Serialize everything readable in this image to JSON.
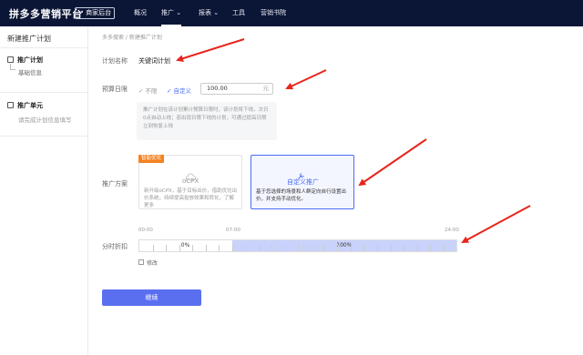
{
  "header": {
    "brand": "拼多多营销平台",
    "store_button": "↗ 商家后台",
    "nav": [
      {
        "label": "概况",
        "chevron": false
      },
      {
        "label": "推广",
        "chevron": true
      },
      {
        "label": "报表",
        "chevron": true
      },
      {
        "label": "工具",
        "chevron": false
      },
      {
        "label": "营销书院",
        "chevron": false
      }
    ],
    "active_nav": "推广"
  },
  "sidebar": {
    "title": "新建推广计划",
    "group1_label": "推广计划",
    "group1_sub": "基础信息",
    "group2_label": "推广单元",
    "group2_hint": "请完成计划信息填写"
  },
  "breadcrumb": "多多搜索 / 新建推广计划",
  "form": {
    "plan_name_label": "计划名称",
    "plan_name_value": "关键词计划",
    "budget_label": "预算日限",
    "budget_option_unlimited": "不限",
    "budget_option_custom": "自定义",
    "budget_value": "100.00",
    "budget_unit": "元",
    "budget_tip": "推广计划在该计划累计预算日限时，该计划将下线，次日0点自动上线；若出现日限下线的计划，可通过提高日限立刻恢复上线",
    "scheme_label": "推广方案",
    "badge": "智能优化",
    "card1_title": "oCPX",
    "card1_desc": "新升级oCPX，基于目标出价，借助优化出价系统，持续提高投放效果和转化，了解更多",
    "card2_title": "自定义推广",
    "card2_desc": "基于您选择的场景和人群定向自行设置出价，并支持手动优化。",
    "time_label": "分时折扣",
    "times": [
      "00:00",
      "07:00",
      "24:00"
    ],
    "segments": [
      {
        "label": "0%",
        "start": 0,
        "end": 7,
        "active": false
      },
      {
        "label": "100%",
        "start": 7,
        "end": 24,
        "active": true
      }
    ],
    "modify_label": "修改",
    "next_button": "继续"
  },
  "colors": {
    "topbar": "#0b1636",
    "accent": "#4a6cf7",
    "button": "#5a6ff0",
    "arrow": "#e8251c",
    "badge": "#f58220"
  }
}
